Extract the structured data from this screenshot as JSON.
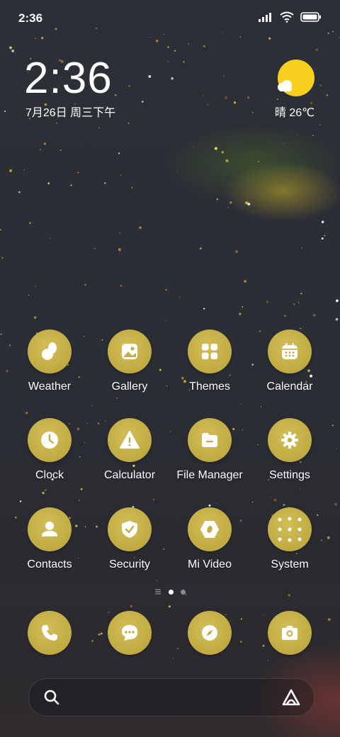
{
  "status_bar": {
    "time": "2:36",
    "icons": [
      "signal-icon",
      "wifi-icon",
      "battery-icon"
    ]
  },
  "clock_widget": {
    "time": "2:36",
    "date": "7月26日 周三下午"
  },
  "weather_widget": {
    "text": "晴 26℃",
    "icon": "sunny-cloud-icon",
    "sun_color": "#f7cf1c"
  },
  "apps": [
    {
      "label": "Weather",
      "icon": "weather-icon"
    },
    {
      "label": "Gallery",
      "icon": "gallery-icon"
    },
    {
      "label": "Themes",
      "icon": "themes-icon"
    },
    {
      "label": "Calendar",
      "icon": "calendar-icon"
    },
    {
      "label": "Clock",
      "icon": "clock-icon"
    },
    {
      "label": "Calculator",
      "icon": "calculator-icon"
    },
    {
      "label": "File Manager",
      "icon": "file-manager-icon"
    },
    {
      "label": "Settings",
      "icon": "settings-icon"
    },
    {
      "label": "Contacts",
      "icon": "contacts-icon"
    },
    {
      "label": "Security",
      "icon": "security-icon"
    },
    {
      "label": "Mi Video",
      "icon": "mi-video-icon"
    },
    {
      "label": "System",
      "icon": "system-folder-icon"
    }
  ],
  "page_indicator": {
    "pages": 2,
    "current": 1
  },
  "dock": [
    {
      "icon": "phone-icon"
    },
    {
      "icon": "messages-icon"
    },
    {
      "icon": "browser-icon"
    },
    {
      "icon": "camera-icon"
    }
  ],
  "search_bar": {
    "left_icon": "search-icon",
    "right_icon": "assistant-icon"
  },
  "colors": {
    "icon_fill": "#c3ad45",
    "glyph": "#ffffff"
  }
}
